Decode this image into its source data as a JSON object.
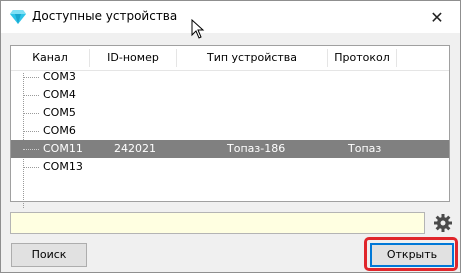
{
  "window": {
    "title": "Доступные устройства",
    "close_glyph": "✕"
  },
  "table": {
    "columns": [
      "Канал",
      "ID-номер",
      "Тип устройства",
      "Протокол"
    ],
    "rows": [
      {
        "channel": "COM3",
        "id": "",
        "type": "",
        "protocol": ""
      },
      {
        "channel": "COM4",
        "id": "",
        "type": "",
        "protocol": ""
      },
      {
        "channel": "COM5",
        "id": "",
        "type": "",
        "protocol": ""
      },
      {
        "channel": "COM6",
        "id": "",
        "type": "",
        "protocol": ""
      },
      {
        "channel": "COM11",
        "id": "242021",
        "type": "Топаз-186",
        "protocol": "Топаз"
      },
      {
        "channel": "COM13",
        "id": "",
        "type": "",
        "protocol": ""
      }
    ],
    "selected_index": 4
  },
  "status": {
    "value": ""
  },
  "buttons": {
    "search_label": "Поиск",
    "open_label": "Открыть"
  },
  "icons": {
    "app": "diamond-icon",
    "settings": "gear-icon",
    "close": "close-icon"
  },
  "colors": {
    "selection": "#808080",
    "status_bg": "#ffffe1",
    "highlight": "#e0262b",
    "default_button_border": "#0078d7"
  }
}
